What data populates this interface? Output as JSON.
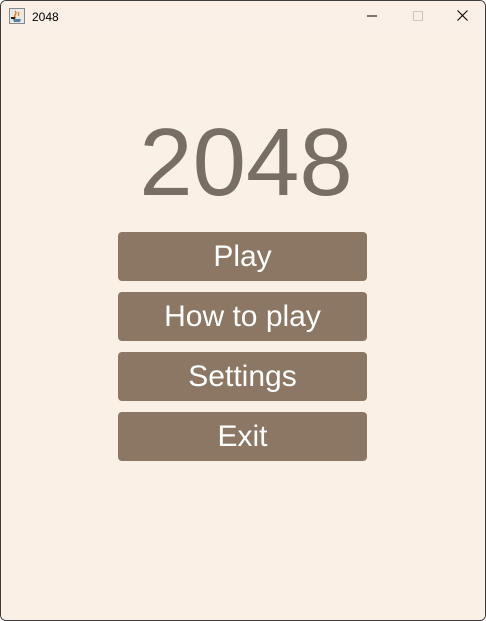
{
  "window": {
    "title": "2048",
    "app_icon": "java-cup-icon",
    "controls": {
      "minimize_icon": "minimize-icon",
      "maximize_icon": "maximize-icon",
      "close_icon": "close-icon"
    }
  },
  "main": {
    "game_title": "2048",
    "menu": [
      {
        "label": "Play"
      },
      {
        "label": "How to play"
      },
      {
        "label": "Settings"
      },
      {
        "label": "Exit"
      }
    ]
  },
  "colors": {
    "background": "#faf0e6",
    "title_text": "#776e65",
    "button_bg": "#8b7763",
    "button_text": "#ffffff"
  }
}
